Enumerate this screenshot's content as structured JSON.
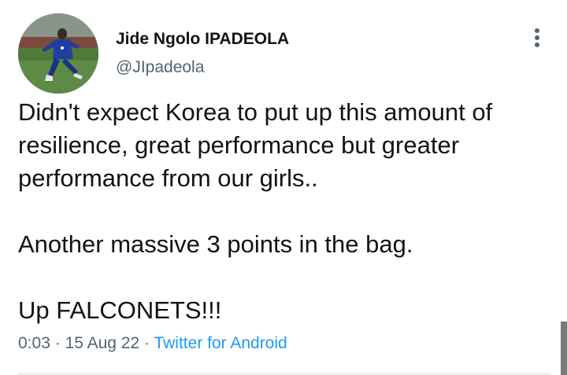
{
  "tweet": {
    "author": {
      "display_name": "Jide Ngolo IPADEOLA",
      "handle": "@JIpadeola"
    },
    "text_lines": [
      "Didn't expect Korea to put up this amount of resilience, great performance but greater performance from our girls..",
      "Another massive 3 points in the bag.",
      "Up FALCONETS!!!"
    ],
    "time": "0:03",
    "separator": "·",
    "date": "15 Aug 22",
    "source": "Twitter for Android"
  },
  "colors": {
    "text_primary": "#0f1419",
    "text_secondary": "#536471",
    "link": "#1d9bf0",
    "divider": "#cfd9de"
  },
  "icons": {
    "more": "more-vertical-icon"
  }
}
